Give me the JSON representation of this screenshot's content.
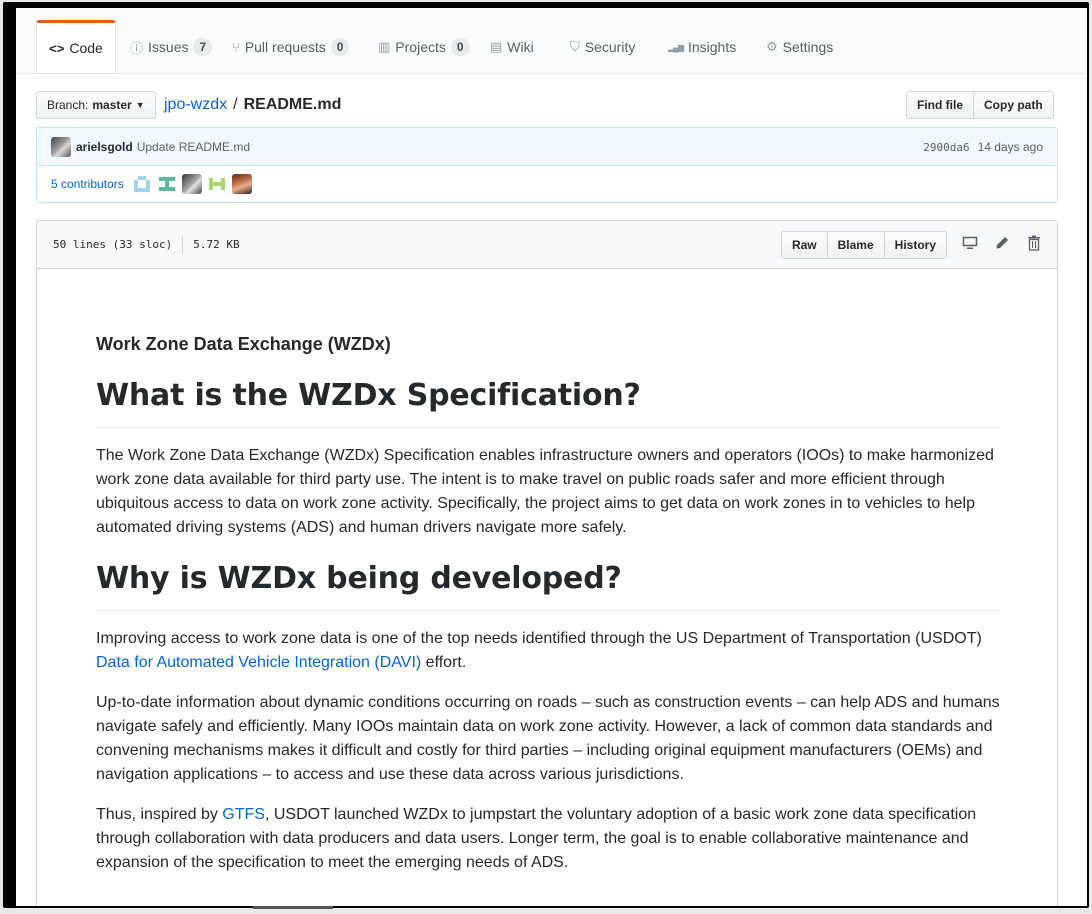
{
  "tabs": [
    {
      "icon": "code-icon",
      "glyph": "<>",
      "label": "Code",
      "count": ""
    },
    {
      "icon": "issue-icon",
      "glyph": "ⓘ",
      "label": "Issues",
      "count": "7"
    },
    {
      "icon": "pull-request-icon",
      "glyph": "⑂",
      "label": "Pull requests",
      "count": "0"
    },
    {
      "icon": "project-icon",
      "glyph": "▥",
      "label": "Projects",
      "count": "0"
    },
    {
      "icon": "wiki-icon",
      "glyph": "▤",
      "label": "Wiki",
      "count": ""
    },
    {
      "icon": "shield-icon",
      "glyph": "⛉",
      "label": "Security",
      "count": ""
    },
    {
      "icon": "graph-icon",
      "glyph": "▂▄▆",
      "label": "Insights",
      "count": ""
    },
    {
      "icon": "gear-icon",
      "glyph": "⚙",
      "label": "Settings",
      "count": ""
    }
  ],
  "breadcrumb": {
    "branch_prefix": "Branch:",
    "branch": "master",
    "repo": "jpo-wzdx",
    "separator": "/",
    "file": "README.md"
  },
  "file_buttons": {
    "find": "Find file",
    "copy": "Copy path"
  },
  "commit": {
    "author": "arielsgold",
    "message": "Update README.md",
    "sha": "2900da6",
    "age": "14 days ago",
    "contributors": "5 contributors"
  },
  "file_info": {
    "lines": "50 lines (33 sloc)",
    "size": "5.72 KB"
  },
  "file_actions": {
    "raw": "Raw",
    "blame": "Blame",
    "history": "History"
  },
  "readme": {
    "title_small": "Work Zone Data Exchange (WZDx)",
    "h1_what": "What is the WZDx Specification?",
    "p_what": "The Work Zone Data Exchange (WZDx) Specification enables infrastructure owners and operators (IOOs) to make harmonized work zone data available for third party use. The intent is to make travel on public roads safer and more efficient through ubiquitous access to data on work zone activity. Specifically, the project aims to get data on work zones in to vehicles to help automated driving systems (ADS) and human drivers navigate more safely.",
    "h1_why": "Why is WZDx being developed?",
    "p_why1_a": "Improving access to work zone data is one of the top needs identified through the US Department of Transportation (USDOT) ",
    "p_why1_link": "Data for Automated Vehicle Integration (DAVI)",
    "p_why1_b": " effort.",
    "p_why2": "Up-to-date information about dynamic conditions occurring on roads – such as construction events – can help ADS and humans navigate safely and efficiently. Many IOOs maintain data on work zone activity. However, a lack of common data standards and convening mechanisms makes it difficult and costly for third parties – including original equipment manufacturers (OEMs) and navigation applications – to access and use these data across various jurisdictions.",
    "p_why3_a": "Thus, inspired by ",
    "p_why3_link": "GTFS",
    "p_why3_b": ", USDOT launched WZDx to jumpstart the voluntary adoption of a basic work zone data specification through collaboration with data producers and data users. Longer term, the goal is to enable collaborative maintenance and expansion of the specification to meet the emerging needs of ADS."
  }
}
